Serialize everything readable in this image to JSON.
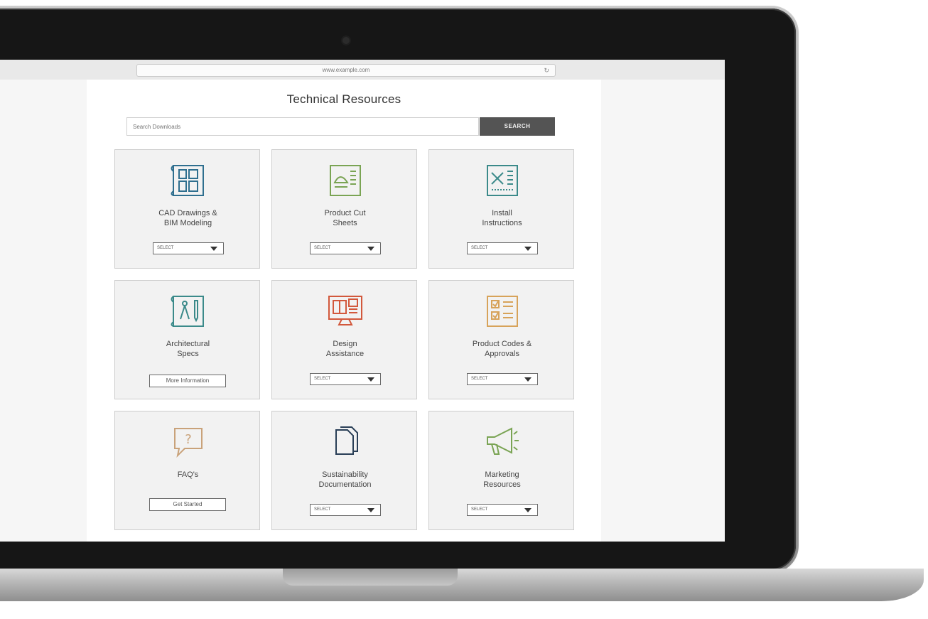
{
  "browser": {
    "url": "www.example.com"
  },
  "page": {
    "title": "Technical Resources",
    "search": {
      "placeholder": "Search Downloads",
      "button_label": "SEARCH"
    }
  },
  "cards": [
    {
      "label": "CAD Drawings &\nBIM Modeling",
      "control": "SELECT",
      "icon": "blueprint-icon",
      "color": "#2f6f8f"
    },
    {
      "label": "Product Cut\nSheets",
      "control": "SELECT",
      "icon": "cut-sheet-icon",
      "color": "#7aa454"
    },
    {
      "label": "Install\nInstructions",
      "control": "SELECT",
      "icon": "tools-icon",
      "color": "#3b8a8a"
    },
    {
      "label": "Architectural\nSpecs",
      "control": "More Information",
      "icon": "compass-pencil-icon",
      "color": "#3b8a8a"
    },
    {
      "label": "Design\nAssistance",
      "control": "SELECT",
      "icon": "monitor-icon",
      "color": "#d2583c"
    },
    {
      "label": "Product Codes &\nApprovals",
      "control": "SELECT",
      "icon": "checklist-icon",
      "color": "#d7a35a"
    },
    {
      "label": "FAQ's",
      "control": "Get Started",
      "icon": "question-bubble-icon",
      "color": "#c9a27a"
    },
    {
      "label": "Sustainability\nDocumentation",
      "control": "SELECT",
      "icon": "documents-icon",
      "color": "#2a3f57"
    },
    {
      "label": "Marketing\nResources",
      "control": "SELECT",
      "icon": "megaphone-icon",
      "color": "#7aa454"
    }
  ]
}
